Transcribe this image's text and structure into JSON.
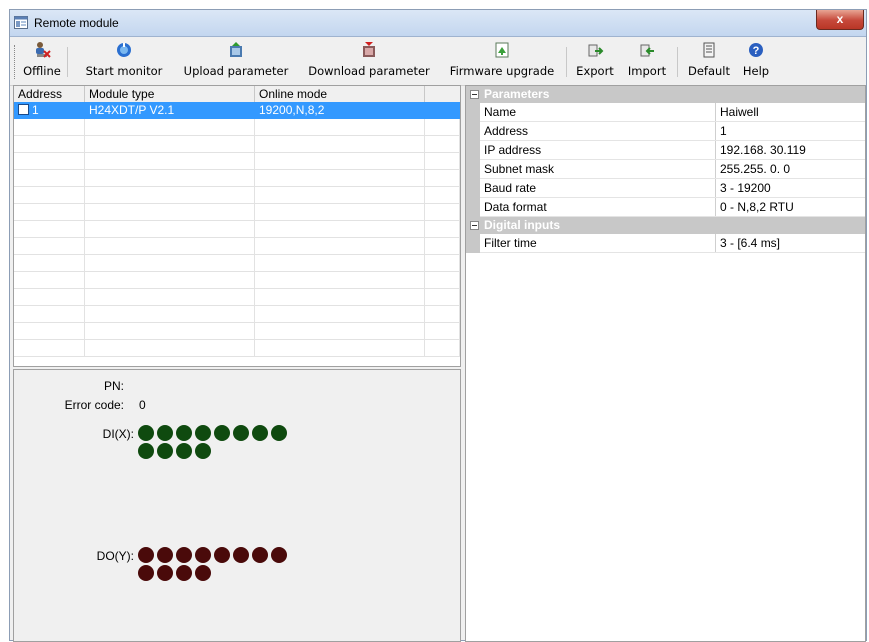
{
  "window": {
    "title": "Remote module",
    "close_glyph": "x"
  },
  "toolbar": {
    "buttons": [
      {
        "label": "Offline",
        "icon": "offline-icon"
      },
      {
        "label": "Start monitor",
        "icon": "monitor-icon"
      },
      {
        "label": "Upload parameter",
        "icon": "upload-icon"
      },
      {
        "label": "Download parameter",
        "icon": "download-icon"
      },
      {
        "label": "Firmware upgrade",
        "icon": "firmware-icon"
      },
      {
        "label": "Export",
        "icon": "export-icon"
      },
      {
        "label": "Import",
        "icon": "import-icon"
      },
      {
        "label": "Default",
        "icon": "default-icon"
      },
      {
        "label": "Help",
        "icon": "help-icon"
      }
    ]
  },
  "module_list": {
    "columns": [
      "Address",
      "Module type",
      "Online mode"
    ],
    "rows": [
      {
        "address": "1",
        "module_type": "H24XDT/P V2.1",
        "online_mode": "19200,N,8,2"
      }
    ]
  },
  "status": {
    "pn_label": "PN:",
    "pn_value": "",
    "error_label": "Error code:",
    "error_value": "0",
    "di_label": "DI(X):",
    "do_label": "DO(Y):",
    "di_count": 12,
    "do_count": 12,
    "di_color": "#0f4a0f",
    "do_color": "#4a0a0a"
  },
  "parameters": {
    "categories": [
      {
        "label": "Parameters",
        "rows": [
          {
            "name": "Name",
            "value": "Haiwell"
          },
          {
            "name": "Address",
            "value": "1"
          },
          {
            "name": "IP address",
            "value": "192.168. 30.119"
          },
          {
            "name": "Subnet mask",
            "value": "255.255. 0. 0"
          },
          {
            "name": "Baud rate",
            "value": "3 - 19200"
          },
          {
            "name": "Data format",
            "value": "0 - N,8,2 RTU"
          }
        ]
      },
      {
        "label": "Digital inputs",
        "rows": [
          {
            "name": "Filter time",
            "value": "3 - [6.4 ms]"
          }
        ]
      }
    ]
  }
}
